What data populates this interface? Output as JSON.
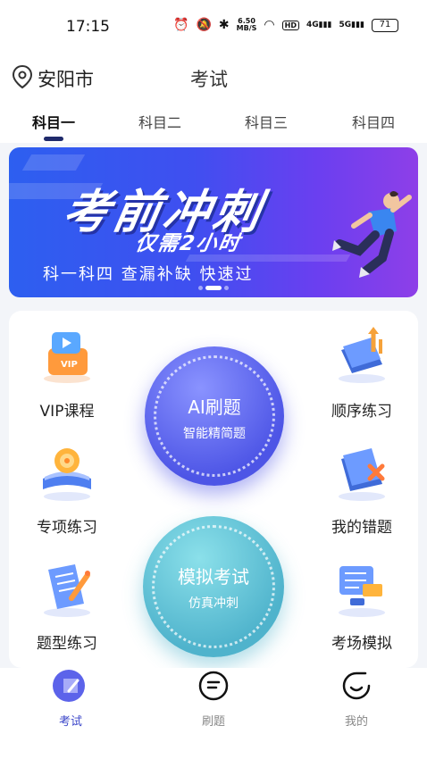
{
  "status_bar": {
    "time": "17:15",
    "network_speed_top": "6.50",
    "network_speed_bottom": "MB/S",
    "hd_badge": "HD",
    "signal1": "4G",
    "signal2": "5G",
    "battery": "71"
  },
  "top_bar": {
    "city": "安阳市",
    "title": "考试"
  },
  "tabs": [
    {
      "label": "科目一",
      "active": true
    },
    {
      "label": "科目二",
      "active": false
    },
    {
      "label": "科目三",
      "active": false
    },
    {
      "label": "科目四",
      "active": false
    }
  ],
  "banner": {
    "headline": "考前冲刺",
    "subline": "仅需2小时",
    "caption": "科一科四  查漏补缺  快速过",
    "slide_count": 3,
    "active_slide": 2
  },
  "tiles": [
    {
      "label": "VIP课程",
      "icon": "vip-video-icon"
    },
    {
      "label": "顺序练习",
      "icon": "ordered-books-icon"
    },
    {
      "label": "专项练习",
      "icon": "target-book-icon"
    },
    {
      "label": "我的错题",
      "icon": "wrong-book-icon"
    },
    {
      "label": "题型练习",
      "icon": "pen-paper-icon"
    },
    {
      "label": "考场模拟",
      "icon": "exam-screen-icon"
    }
  ],
  "circles": {
    "ai": {
      "title": "AI刷题",
      "subtitle": "智能精简题"
    },
    "mock": {
      "title": "模拟考试",
      "subtitle": "仿真冲刺"
    }
  },
  "bottom_nav": [
    {
      "label": "考试",
      "icon": "exam-edit-icon",
      "active": true
    },
    {
      "label": "刷题",
      "icon": "practice-list-icon",
      "active": false
    },
    {
      "label": "我的",
      "icon": "profile-smile-icon",
      "active": false
    }
  ],
  "colors": {
    "accent": "#3b46c9",
    "ai_circle": "#5c63ea",
    "mock_circle": "#5ec0d4",
    "banner": "#4a4ff0"
  }
}
